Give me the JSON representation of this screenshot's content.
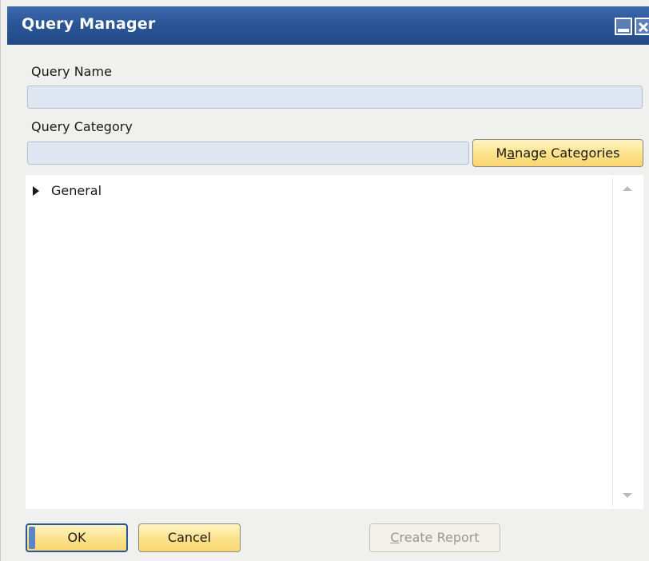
{
  "window": {
    "title": "Query Manager"
  },
  "form": {
    "query_name_label": "Query Name",
    "query_name_value": "",
    "query_category_label": "Query Category",
    "query_category_value": "",
    "manage_categories_label_pre": "M",
    "manage_categories_label_ul": "a",
    "manage_categories_label_post": "nage Categories"
  },
  "tree": {
    "items": [
      {
        "label": "General",
        "expanded": false
      }
    ]
  },
  "footer": {
    "ok_label": "OK",
    "cancel_label": "Cancel",
    "create_report_label_ul": "C",
    "create_report_label_post": "reate Report",
    "create_report_enabled": false
  },
  "icons": {
    "minimize": "minimize-icon",
    "close": "close-icon",
    "tree_expand": "triangle-right-icon",
    "scroll_up": "arrow-up-icon",
    "scroll_down": "arrow-down-icon"
  },
  "colors": {
    "titlebar": "#2b5596",
    "button": "#fde28a",
    "field": "#dde6f1"
  }
}
